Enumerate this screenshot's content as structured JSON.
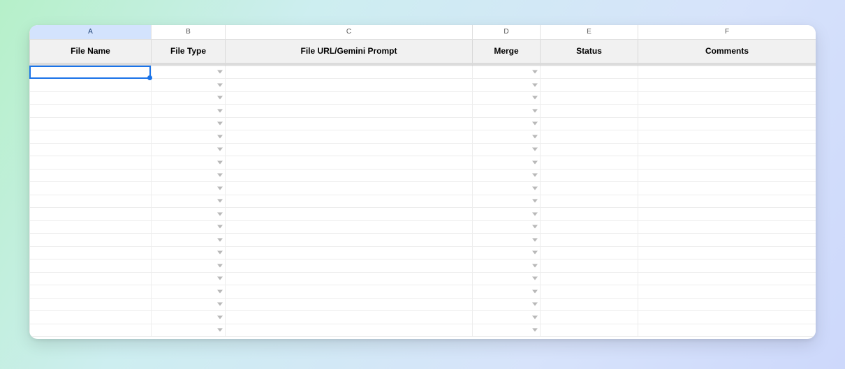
{
  "columns": [
    {
      "letter": "A",
      "header": "File Name",
      "dropdown": false,
      "selected": true
    },
    {
      "letter": "B",
      "header": "File Type",
      "dropdown": true,
      "selected": false
    },
    {
      "letter": "C",
      "header": "File URL/Gemini Prompt",
      "dropdown": false,
      "selected": false
    },
    {
      "letter": "D",
      "header": "Merge",
      "dropdown": true,
      "selected": false
    },
    {
      "letter": "E",
      "header": "Status",
      "dropdown": false,
      "selected": false
    },
    {
      "letter": "F",
      "header": "Comments",
      "dropdown": false,
      "selected": false
    }
  ],
  "row_count": 21,
  "active_cell": {
    "col": "A",
    "row": 1
  }
}
